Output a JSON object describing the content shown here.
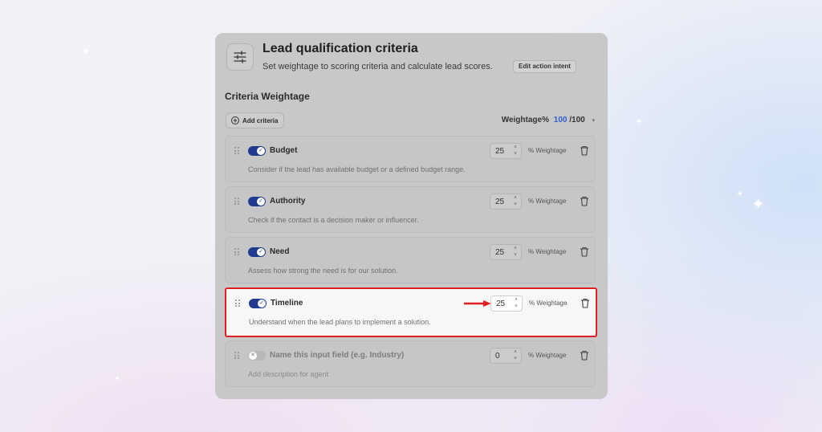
{
  "panel": {
    "title": "Lead qualification criteria",
    "subtitle": "Set weightage to scoring criteria and calculate lead scores.",
    "icon": "sliders-icon",
    "edit_intent_label": "Edit action intent"
  },
  "criteria_section": {
    "title": "Criteria Weightage",
    "add_button_label": "Add criteria",
    "weightage_label": "Weightage%",
    "weightage_current": "100",
    "weightage_max": "/100"
  },
  "criteria": [
    {
      "name": "Budget",
      "description": "Consider if the lead has available budget or a defined budget range.",
      "weight": "25",
      "weight_suffix": "% Weightage",
      "enabled": true
    },
    {
      "name": "Authority",
      "description": "Check if the contact is a decision maker or influencer.",
      "weight": "25",
      "weight_suffix": "% Weightage",
      "enabled": true
    },
    {
      "name": "Need",
      "description": "Assess how strong the need is for our solution.",
      "weight": "25",
      "weight_suffix": "% Weightage",
      "enabled": true
    },
    {
      "name": "Timeline",
      "description": "Understand when the lead plans to implement a solution.",
      "weight": "25",
      "weight_suffix": "% Weightage",
      "enabled": true,
      "highlighted": true
    },
    {
      "name": "Name this input field (e.g. Industry)",
      "description": "Add description for agent",
      "weight": "0",
      "weight_suffix": "% Weightage",
      "enabled": false
    }
  ],
  "colors": {
    "accent_blue": "#2f5fd0",
    "toggle_on": "#1f3a8f",
    "highlight_red": "#e02020"
  }
}
